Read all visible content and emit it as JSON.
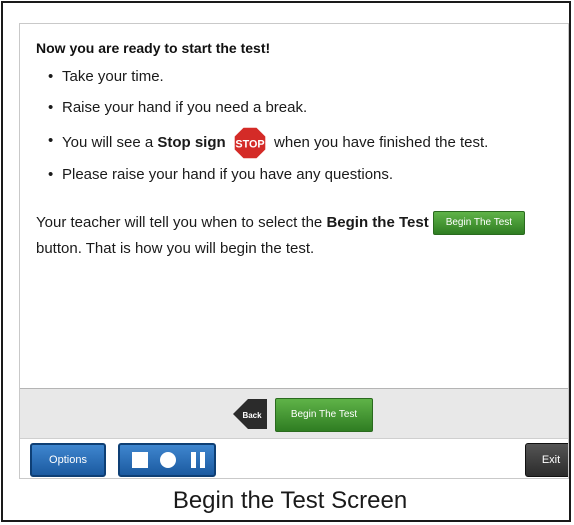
{
  "screen": {
    "heading": "Now you are ready to start the test!",
    "bullets": {
      "b1": "Take your time.",
      "b2": "Raise your hand if you need a break.",
      "b3_pre": "You will see a",
      "b3_bold": "Stop sign",
      "b3_post": "when you have finished the test.",
      "b4": "Please raise your hand if you have any questions."
    },
    "stop_sign_text": "STOP",
    "paragraph": {
      "pre": "Your teacher will tell you when to select the",
      "bold": "Begin the Test",
      "post": "button. That is how you will begin the test."
    },
    "inline_button": "Begin The Test"
  },
  "toolbar": {
    "back_label": "Back",
    "begin_label": "Begin The Test",
    "options_label": "Options",
    "exit_label": "Exit"
  },
  "caption": "Begin the Test Screen",
  "colors": {
    "green": "#3f9a2e",
    "blue": "#1b5aa0",
    "stop_red": "#d42b27"
  }
}
